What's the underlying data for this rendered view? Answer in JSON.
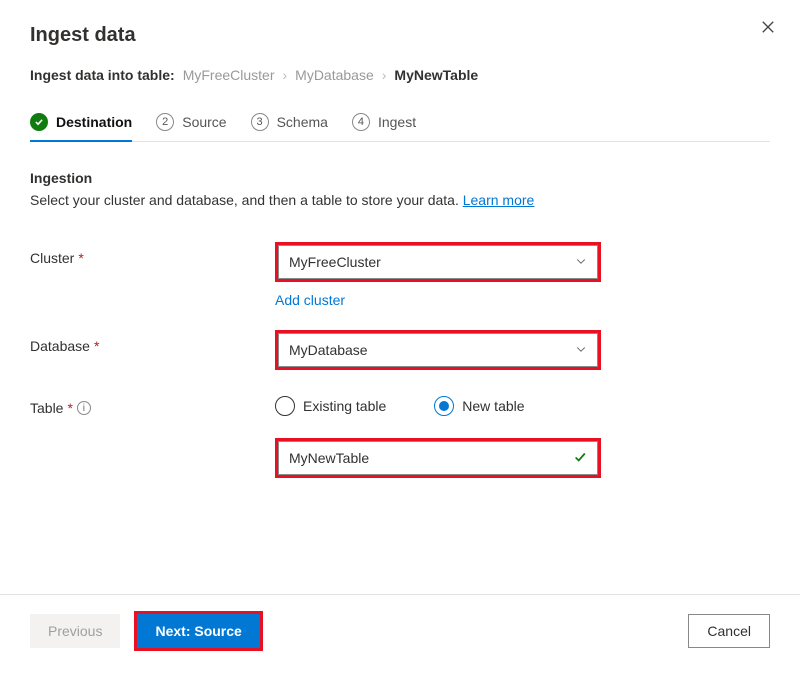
{
  "header": {
    "title": "Ingest data"
  },
  "breadcrumb": {
    "label": "Ingest data into table:",
    "items": [
      "MyFreeCluster",
      "MyDatabase",
      "MyNewTable"
    ]
  },
  "tabs": [
    {
      "label": "Destination",
      "state": "done",
      "active": true
    },
    {
      "num": "2",
      "label": "Source"
    },
    {
      "num": "3",
      "label": "Schema"
    },
    {
      "num": "4",
      "label": "Ingest"
    }
  ],
  "section": {
    "title": "Ingestion",
    "desc": "Select your cluster and database, and then a table to store your data. ",
    "learn_more": "Learn more"
  },
  "form": {
    "cluster": {
      "label": "Cluster",
      "value": "MyFreeCluster",
      "add_link": "Add cluster"
    },
    "database": {
      "label": "Database",
      "value": "MyDatabase"
    },
    "table": {
      "label": "Table",
      "radio_existing": "Existing table",
      "radio_new": "New table",
      "value": "MyNewTable"
    }
  },
  "footer": {
    "previous": "Previous",
    "next": "Next: Source",
    "cancel": "Cancel"
  }
}
